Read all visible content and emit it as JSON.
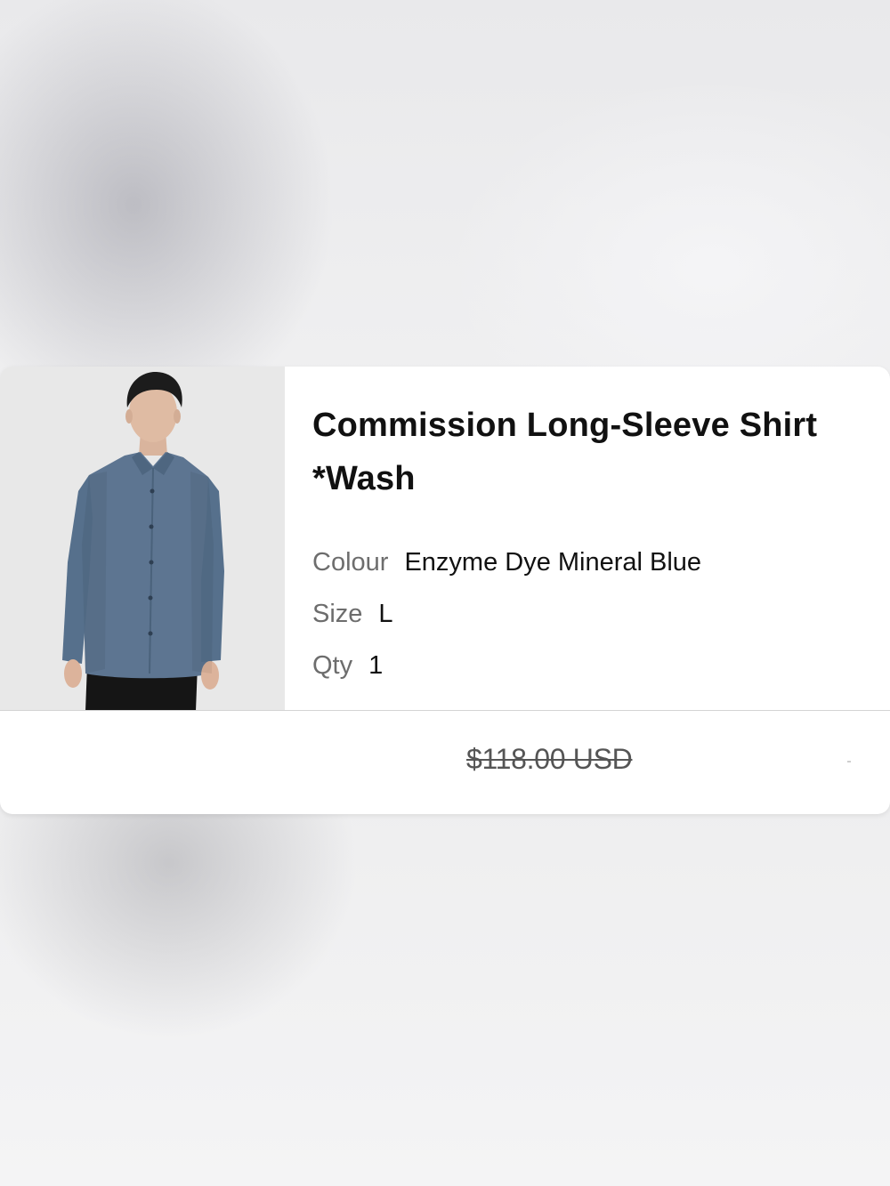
{
  "product": {
    "title_line1": "Commission Long-Sleeve Shirt",
    "title_line2": "*Wash",
    "image_alt_icon": "shirt-model-photo",
    "attributes": [
      {
        "label": "Colour",
        "value": "Enzyme Dye Mineral Blue"
      },
      {
        "label": "Size",
        "value": "L"
      },
      {
        "label": "Qty",
        "value": "1"
      }
    ],
    "price_original": "$118.00 USD"
  },
  "colors": {
    "card_background": "#ffffff",
    "shirt_blue": "#5d7591",
    "text_primary": "#111111",
    "text_secondary": "#6d6d6d"
  }
}
